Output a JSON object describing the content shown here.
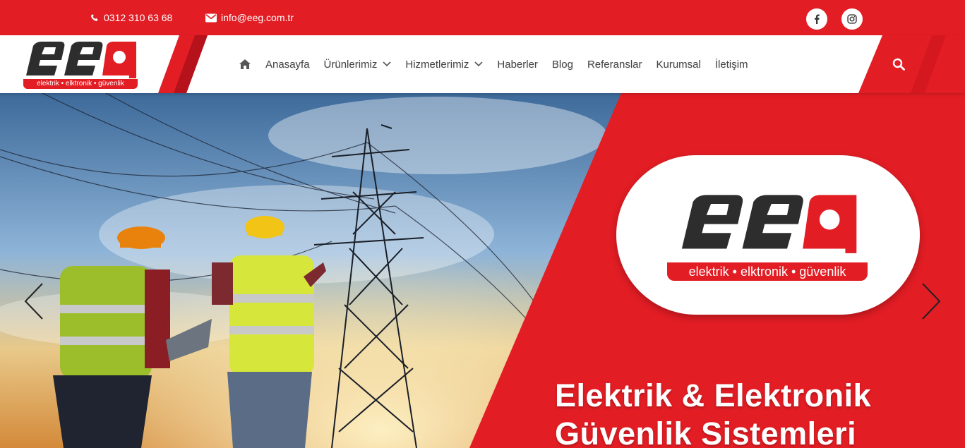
{
  "topbar": {
    "phone": "0312 310 63 68",
    "email": "info@eeg.com.tr",
    "social": [
      {
        "icon": "facebook-icon"
      },
      {
        "icon": "instagram-icon"
      }
    ]
  },
  "logo": {
    "text": "eeg",
    "tagline": "elektrik • elktronik • güvenlik"
  },
  "nav": {
    "home_icon": "home-icon",
    "items": [
      {
        "label": "Anasayfa",
        "dropdown": false
      },
      {
        "label": "Ürünlerimiz",
        "dropdown": true
      },
      {
        "label": "Hizmetlerimiz",
        "dropdown": true
      },
      {
        "label": "Haberler",
        "dropdown": false
      },
      {
        "label": "Blog",
        "dropdown": false
      },
      {
        "label": "Referanslar",
        "dropdown": false
      },
      {
        "label": "Kurumsal",
        "dropdown": false
      },
      {
        "label": "İletişim",
        "dropdown": false
      }
    ],
    "search_icon": "search-icon"
  },
  "hero": {
    "badge_logo_text": "eeg",
    "badge_tagline": "elektrik • elktronik • güvenlik",
    "title_line1": "Elektrik & Elektronik",
    "title_line2": "Güvenlik Sistemleri"
  },
  "colors": {
    "brand_red": "#e21d24",
    "dark_red": "#b5121b",
    "logo_dark": "#2d2d2d",
    "nav_text": "#444444"
  }
}
